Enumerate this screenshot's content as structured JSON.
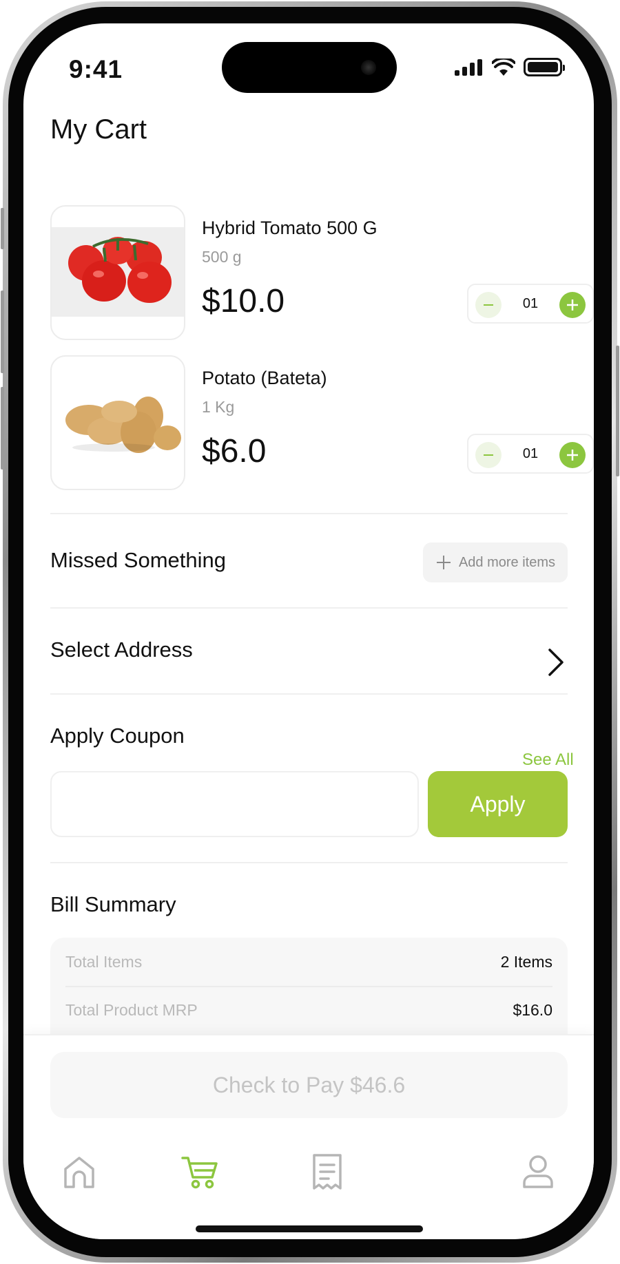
{
  "status_bar": {
    "time": "9:41"
  },
  "page_title": "My Cart",
  "cart_items": [
    {
      "name": "Hybrid Tomato 500 G",
      "weight": "500 g",
      "price": "$10.0",
      "quantity": "01",
      "image": "tomato"
    },
    {
      "name": "Potato (Bateta)",
      "weight": "1 Kg",
      "price": "$6.0",
      "quantity": "01",
      "image": "potato"
    }
  ],
  "missed_something": {
    "title": "Missed Something",
    "button_label": "Add more items"
  },
  "select_address": {
    "title": "Select Address"
  },
  "coupon": {
    "title": "Apply Coupon",
    "see_all": "See All",
    "input_value": "",
    "apply_label": "Apply"
  },
  "bill_summary": {
    "title": "Bill Summary",
    "rows": [
      {
        "label": "Total Items",
        "value": "2 Items"
      },
      {
        "label": "Total Product MRP",
        "value": "$16.0"
      }
    ]
  },
  "checkout": {
    "label": "Check to Pay $46.6"
  },
  "tabs": [
    {
      "name": "home",
      "icon": "home-icon",
      "active": false
    },
    {
      "name": "cart",
      "icon": "cart-icon",
      "active": true
    },
    {
      "name": "orders",
      "icon": "receipt-icon",
      "active": false
    },
    {
      "name": "profile",
      "icon": "user-icon",
      "active": false
    }
  ],
  "colors": {
    "accent": "#8cc63f",
    "apply_button": "#a3c93a",
    "muted_text": "#9a9a9a",
    "inactive_icon": "#b5b5b5"
  }
}
